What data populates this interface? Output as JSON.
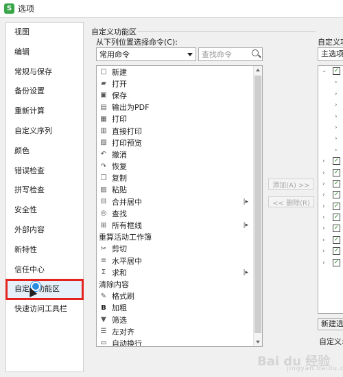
{
  "window": {
    "title": "选项",
    "app_icon": "S"
  },
  "sidebar": {
    "items": [
      {
        "label": "视图"
      },
      {
        "label": "编辑"
      },
      {
        "label": "常规与保存"
      },
      {
        "label": "备份设置"
      },
      {
        "label": "重新计算"
      },
      {
        "label": "自定义序列"
      },
      {
        "label": "颜色"
      },
      {
        "label": "错误检查"
      },
      {
        "label": "拼写检查"
      },
      {
        "label": "安全性"
      },
      {
        "label": "外部内容"
      },
      {
        "label": "新特性"
      },
      {
        "label": "信任中心"
      },
      {
        "label": "自定义功能区"
      },
      {
        "label": "快速访问工具栏"
      }
    ],
    "active_index": 13,
    "highlight_color": "#e4231f"
  },
  "ribbon": {
    "group_title": "自定义功能区",
    "from_label": "从下列位置选择命令(C):",
    "command_source": "常用命令",
    "search_placeholder": "查找命令",
    "commands": [
      {
        "label": "新建",
        "icon": "new-doc-icon"
      },
      {
        "label": "打开",
        "icon": "folder-icon"
      },
      {
        "label": "保存",
        "icon": "save-icon"
      },
      {
        "label": "输出为PDF",
        "icon": "pdf-icon"
      },
      {
        "label": "打印",
        "icon": "print-icon"
      },
      {
        "label": "直接打印",
        "icon": "direct-print-icon"
      },
      {
        "label": "打印预览",
        "icon": "print-preview-icon"
      },
      {
        "label": "撤消",
        "icon": "undo-icon"
      },
      {
        "label": "恢复",
        "icon": "redo-icon"
      },
      {
        "label": "复制",
        "icon": "copy-icon"
      },
      {
        "label": "粘贴",
        "icon": "paste-icon"
      },
      {
        "label": "合并居中",
        "icon": "merge-center-icon",
        "submenu": true
      },
      {
        "label": "查找",
        "icon": "find-icon"
      },
      {
        "label": "所有框线",
        "icon": "borders-icon",
        "submenu": true
      },
      {
        "label": "重算活动工作簿",
        "header": true
      },
      {
        "label": "剪切",
        "icon": "scissors-icon"
      },
      {
        "label": "水平居中",
        "icon": "align-center-icon"
      },
      {
        "label": "求和",
        "icon": "sum-icon",
        "submenu": true
      },
      {
        "label": "清除内容",
        "header": true
      },
      {
        "label": "格式刷",
        "icon": "format-painter-icon"
      },
      {
        "label": "加粗",
        "icon": "bold-icon"
      },
      {
        "label": "筛选",
        "icon": "filter-icon"
      },
      {
        "label": "左对齐",
        "icon": "align-left-icon"
      },
      {
        "label": "自动换行",
        "icon": "wrap-text-icon"
      }
    ],
    "add_button": "添加(A) >>",
    "remove_button": "<< 删除(R)",
    "right_title": "自定义功",
    "right_dropdown": "主选项",
    "new_tab_button": "新建选",
    "custom_label": "自定义:"
  },
  "watermark": {
    "main": "Bai du 经验",
    "sub": "jingyan.baidu.com"
  }
}
